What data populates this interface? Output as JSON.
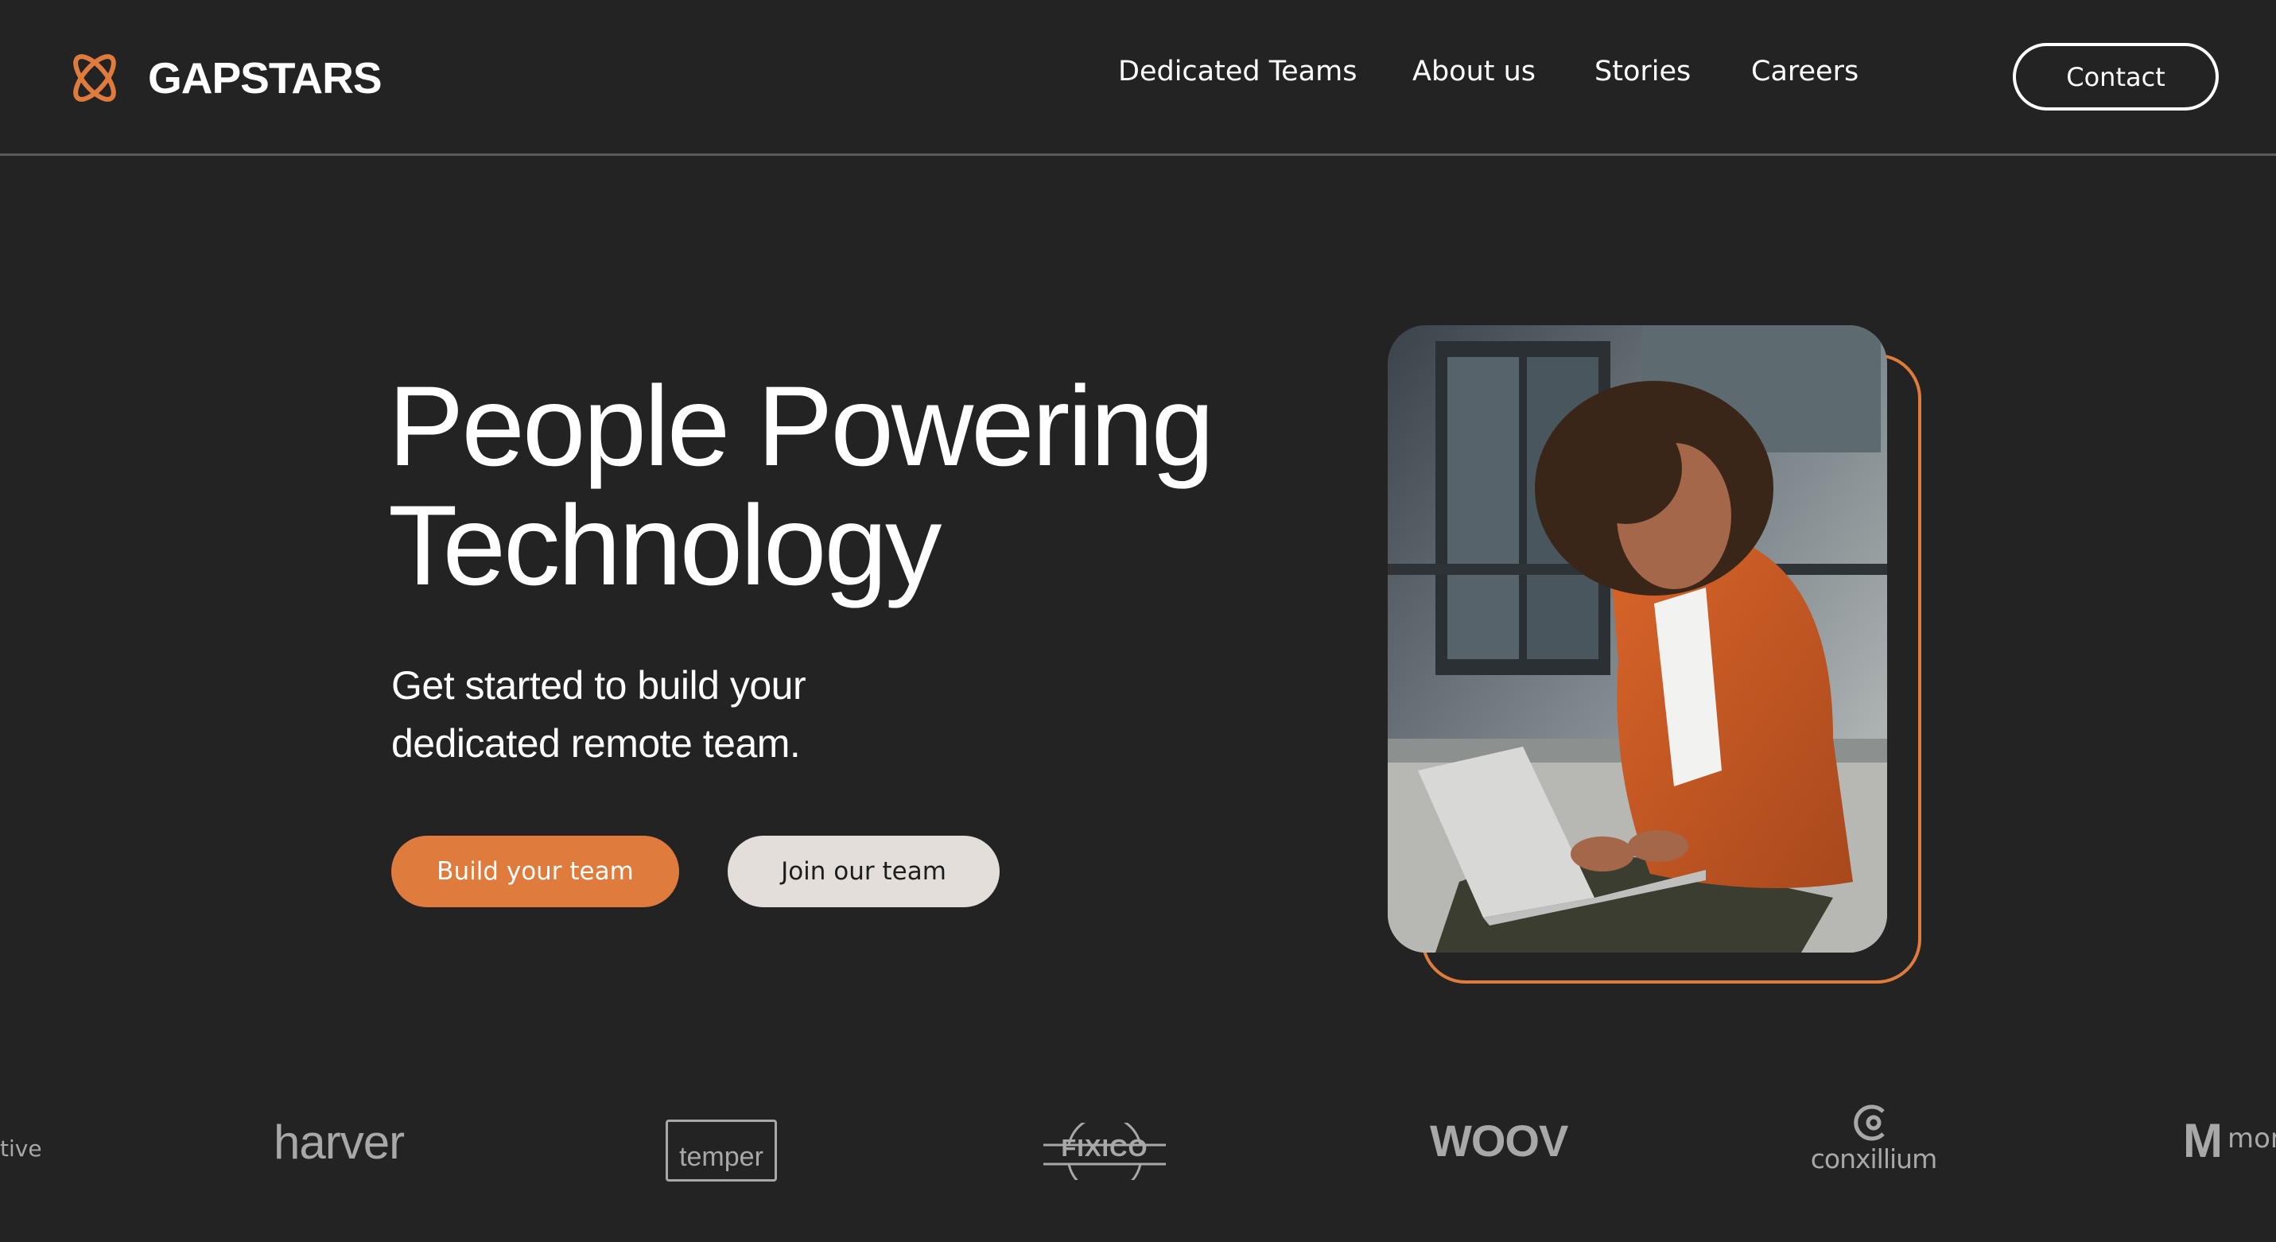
{
  "brand": {
    "name": "GAPSTARS",
    "accent_color": "#df7b3c",
    "background_color": "#232323",
    "secondary_button_color": "#e3ded9",
    "logo_icon": "gapstars-logo-icon"
  },
  "nav": {
    "items": [
      {
        "label": "Dedicated Teams"
      },
      {
        "label": "About us"
      },
      {
        "label": "Stories"
      },
      {
        "label": "Careers"
      }
    ],
    "contact_label": "Contact"
  },
  "hero": {
    "title_line1": "People Powering",
    "title_line2": "Technology",
    "subtitle_line1": "Get started to build your",
    "subtitle_line2": "dedicated remote team.",
    "primary_button": "Build your team",
    "secondary_button": "Join our team",
    "image": "woman-working-on-laptop-photo"
  },
  "clients": {
    "logos": [
      {
        "name": "tive"
      },
      {
        "name": "harver"
      },
      {
        "name": "temper"
      },
      {
        "name": "FIXICO"
      },
      {
        "name": "WOOV"
      },
      {
        "name": "conxillium"
      },
      {
        "name": "mon",
        "letter": "M"
      }
    ]
  }
}
